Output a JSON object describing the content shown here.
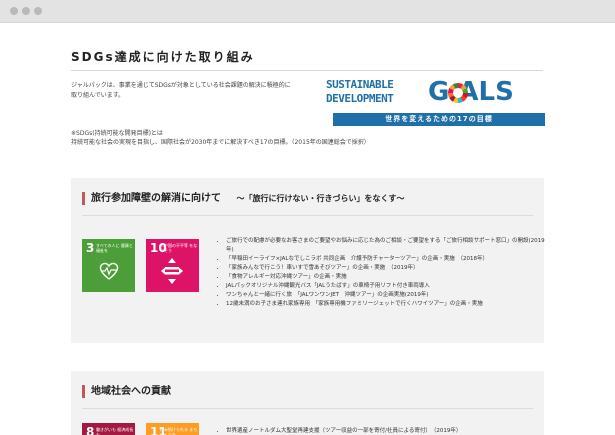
{
  "browser": {
    "title_dots": [
      "close",
      "minimize",
      "maximize"
    ]
  },
  "page": {
    "title": "SDGs達成に向けた取り組み",
    "intro": "ジャルパックは、事業を通じてSDGsが対象としている社会課題の解決に積極的に取り組んでいます。",
    "note_line1": "※SDGs(持続可能な開発目標)とは",
    "note_line2": "持続可能な社会の実現を目指し、国際社会が2030年までに解決すべき17の目標。（2015年の国連総会で採択）",
    "logo_line1": "SUSTAINABLE",
    "logo_line2": "DEVELOPMENT",
    "logo_goals": "G    ALS",
    "logo_band": "世界を変えるための17の目標"
  },
  "section1": {
    "title": "旅行参加障壁の解消に向けて",
    "subtitle": "〜「旅行に行けない・行きづらい」をなくす〜",
    "tile3_num": "3",
    "tile3_label": "すべての人に 健康と福祉を",
    "tile10_num": "10",
    "tile10_label": "人や国の不平等 をなくそう",
    "items": [
      "ご旅行での配慮が必要なお客さまのご要望やお悩みに応じた為のご相談・ご要望をする「ご旅行相談サポート窓口」の開設(2019年)",
      "「早稲田イーライフ×JALなでしこラボ 共同企画　介護予防チャーターツアー」の企画・実施　（2018年）",
      "「家族みんなで行こう！車いすで雪あそびツアー」の企画・実施　（2019年）",
      "「食物アレルギー対応沖縄ツアー」の企画・実施",
      "JALパックオリジナル沖縄観光バス「JALうたばす」の車椅子用リフト付き車両導入",
      "ワンちゃんと一緒に行く旅　「JALワンワンJET　沖縄ツアー」の企画実施(2019年)",
      "12歳未満のお子さま連れ家族専用　「家族専用機ファミリージェットで行くハワイツアー」の企画・実施"
    ]
  },
  "section2": {
    "title": "地域社会への貢献",
    "tile8_num": "8",
    "tile8_label": "働きがいも 経済成長も",
    "tile11_num": "11",
    "tile11_label": "住み続けられる まちづくりを",
    "items": [
      "世界遺産ノートルダム大聖堂再建支援（ツアー収益の一部を寄付/社員による寄付）　（2019年）"
    ]
  },
  "colors": {
    "goal3": "#4c9f38",
    "goal10": "#dd1367",
    "goal8": "#a21942",
    "goal11": "#fd9d24",
    "brand": "#1f6fa8",
    "accent": "#c05a5a"
  }
}
